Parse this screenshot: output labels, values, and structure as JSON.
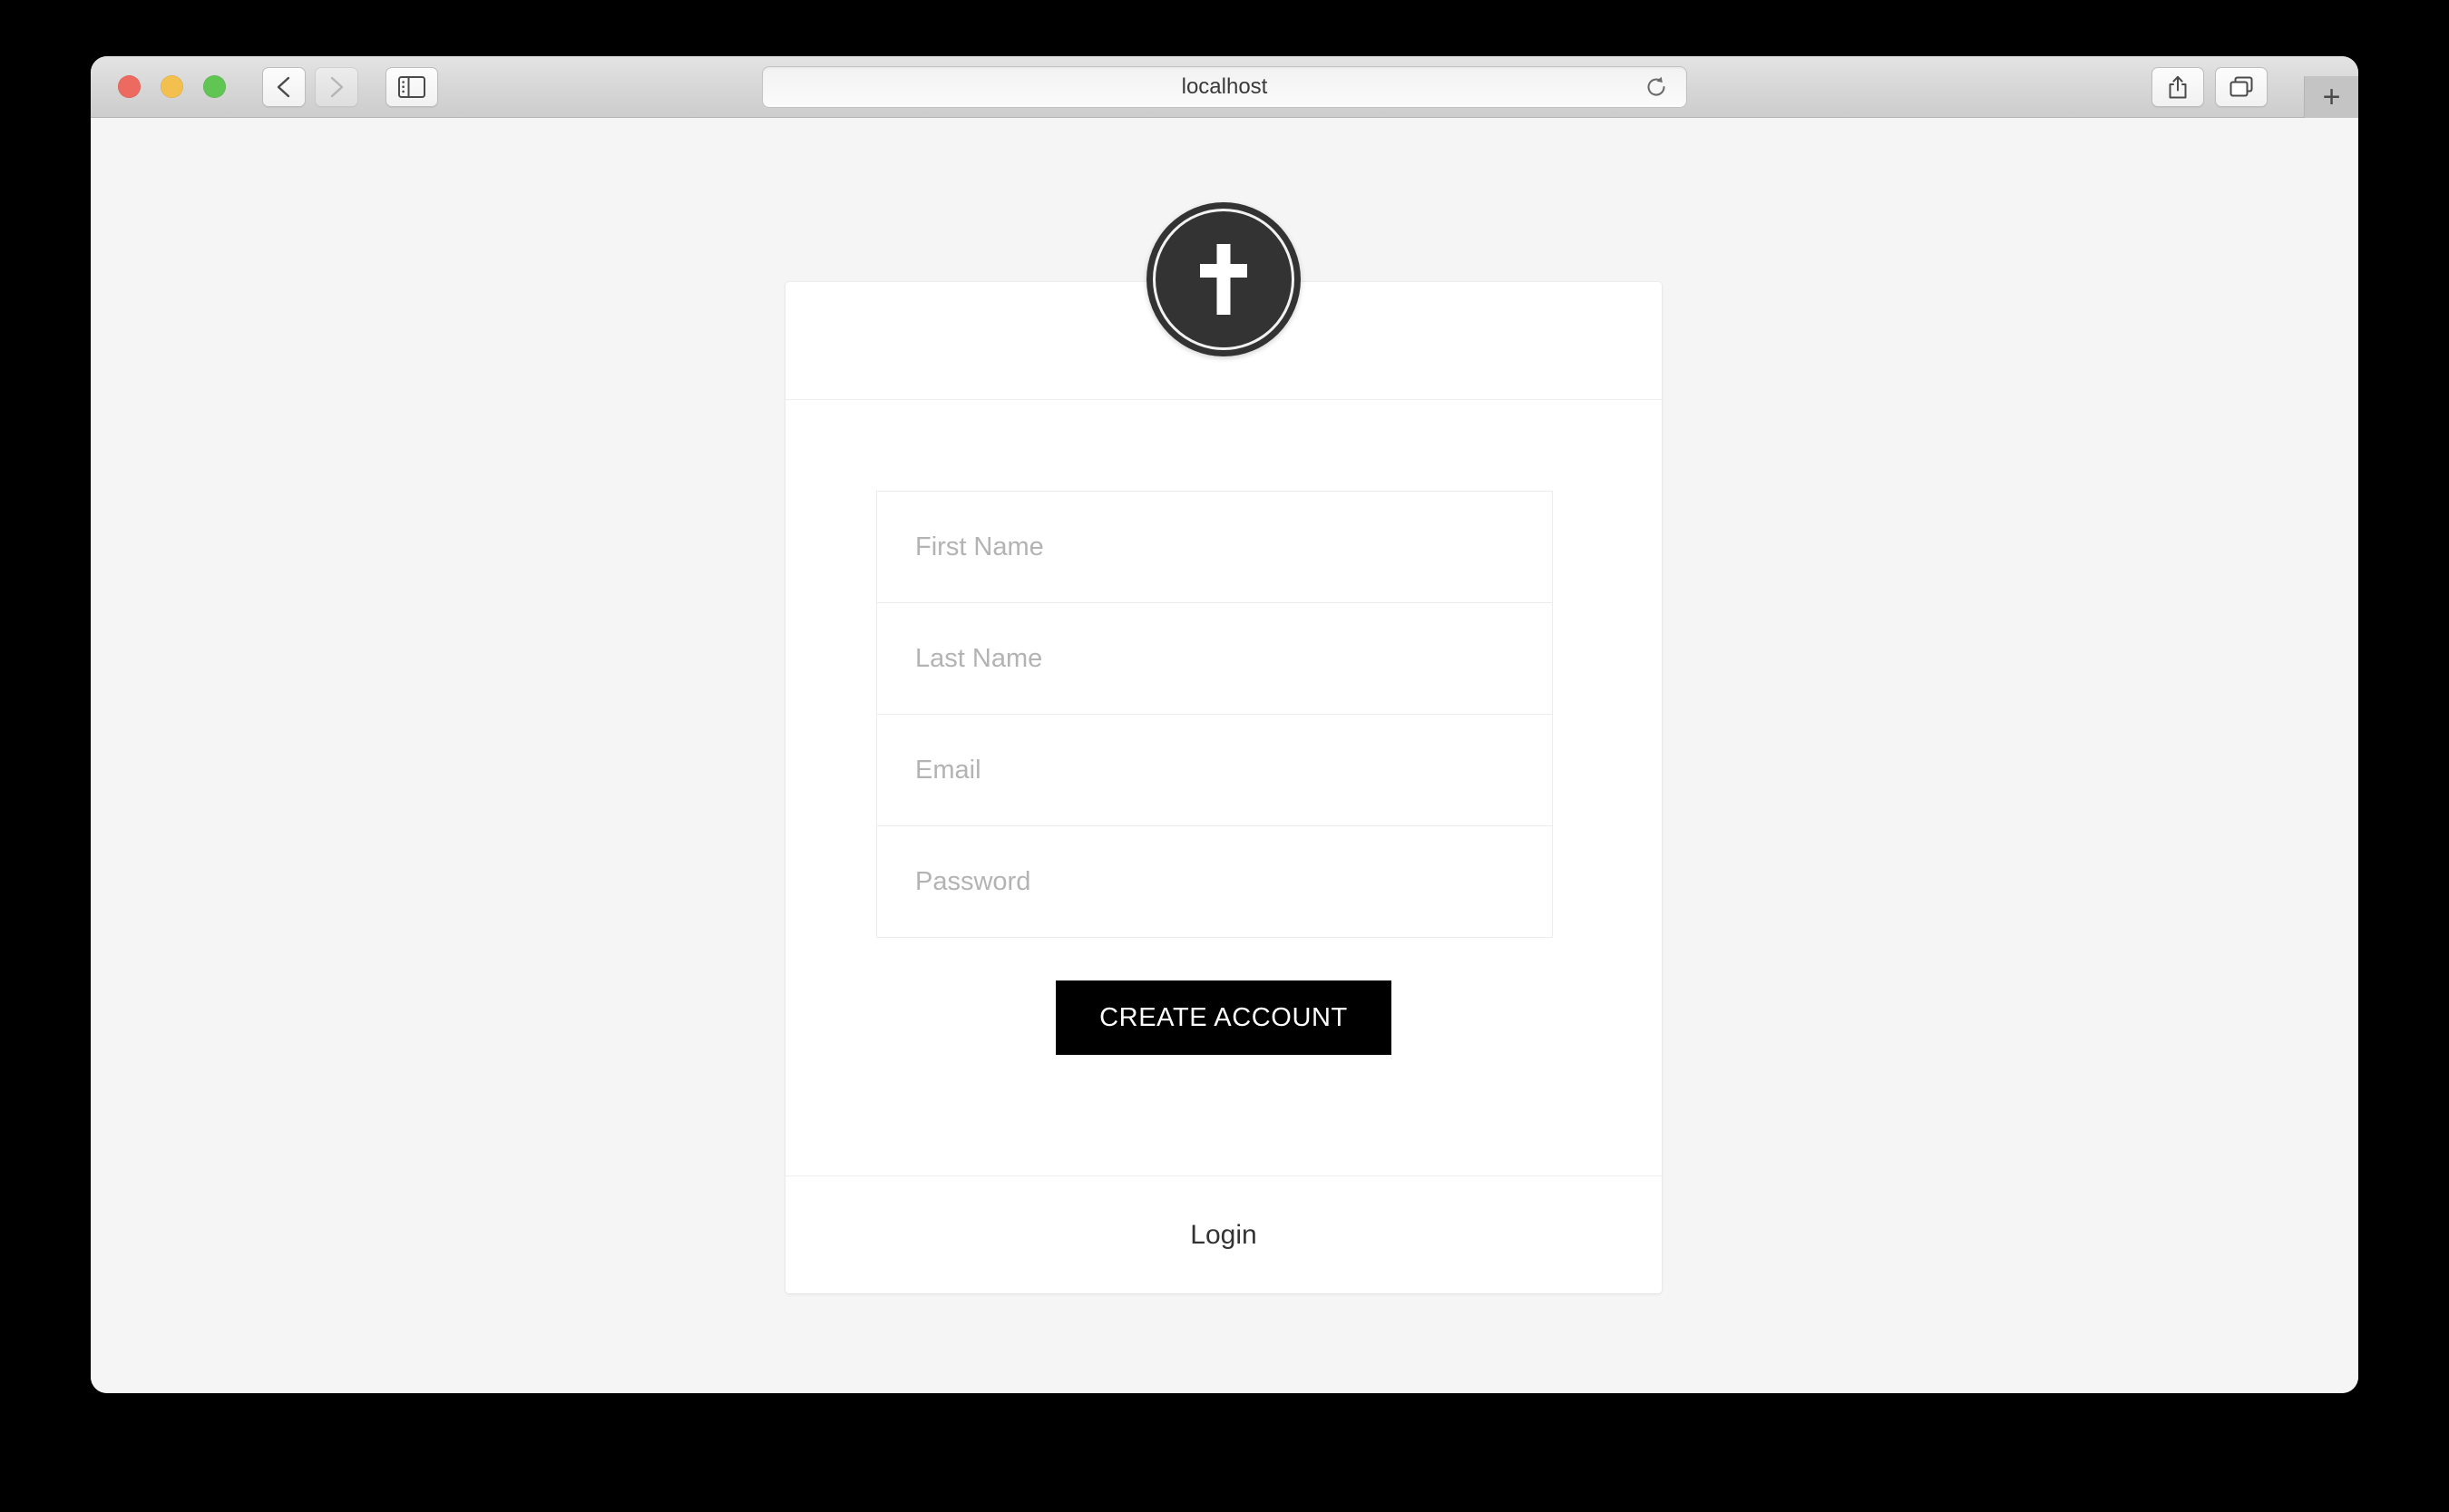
{
  "browser": {
    "address_value": "localhost",
    "traffic_lights": [
      {
        "name": "close-button",
        "color": "#ec6a5f"
      },
      {
        "name": "minimize-button",
        "color": "#f3bf4f"
      },
      {
        "name": "maximize-button",
        "color": "#61c554"
      }
    ],
    "back_icon": "chevron-left-icon",
    "forward_icon": "chevron-right-icon",
    "sidebar_icon": "sidebar-toggle-icon",
    "reload_icon": "reload-icon",
    "share_icon": "share-icon",
    "tabs_overview_icon": "tabs-overview-icon",
    "new_tab_label": "+"
  },
  "page": {
    "background_color": "#f5f5f5",
    "card": {
      "logo": {
        "icon": "cross-icon",
        "background_color": "#333333",
        "foreground_color": "#ffffff"
      },
      "fields": [
        {
          "name": "first-name-field",
          "placeholder": "First Name",
          "value": "",
          "type": "text"
        },
        {
          "name": "last-name-field",
          "placeholder": "Last Name",
          "value": "",
          "type": "text"
        },
        {
          "name": "email-field",
          "placeholder": "Email",
          "value": "",
          "type": "email"
        },
        {
          "name": "password-field",
          "placeholder": "Password",
          "value": "",
          "type": "password"
        }
      ],
      "submit_label": "CREATE ACCOUNT",
      "submit_background": "#000000",
      "submit_color": "#ffffff",
      "footer_link_label": "Login"
    }
  }
}
